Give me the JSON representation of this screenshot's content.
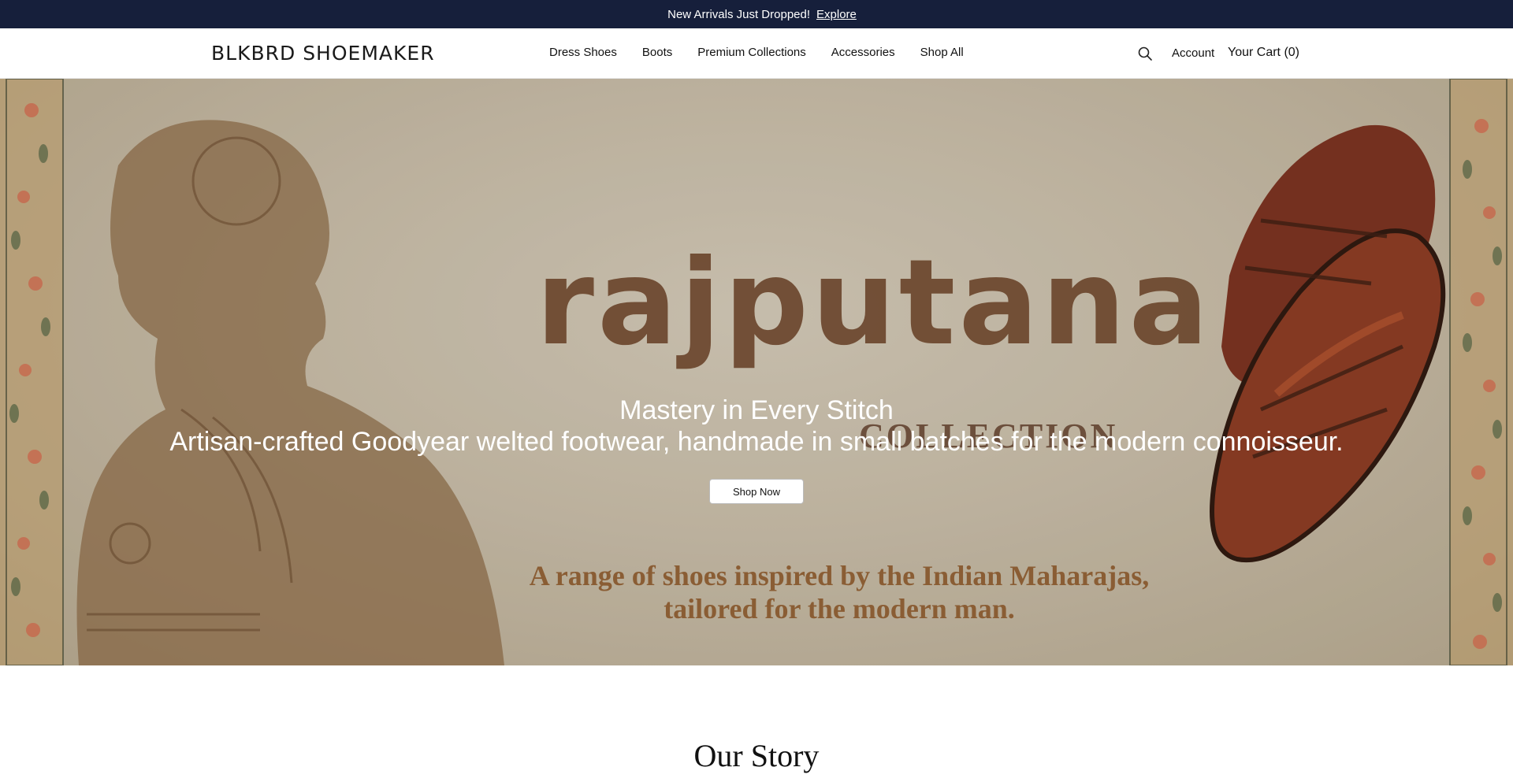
{
  "announcement": {
    "text": "New Arrivals Just Dropped!",
    "link": "Explore",
    "lead_glyph": "",
    "close_glyph": ""
  },
  "header": {
    "logo": "BLKBRD SHOEMAKER",
    "nav": [
      "Dress Shoes",
      "Boots",
      "Premium Collections",
      "Accessories",
      "Shop All"
    ],
    "search_icon": "search-icon",
    "account": "Account",
    "cart": "Your Cart (0)"
  },
  "hero": {
    "brand_title": "rajputana",
    "brand_sub": "COLLECTION",
    "tagline_line1": "A range of shoes inspired by the Indian Maharajas,",
    "tagline_line2": "tailored for the modern man.",
    "heading": "Mastery in Every Stitch",
    "subheading": "Artisan-crafted Goodyear welted footwear, handmade in small batches for the modern connoisseur.",
    "cta": "Shop Now"
  },
  "story": {
    "title": "Our Story"
  },
  "colors": {
    "announcement_bg": "#161f3b",
    "hero_text_brown": "#6e4a31",
    "tagline_brown": "#8a5d34"
  }
}
